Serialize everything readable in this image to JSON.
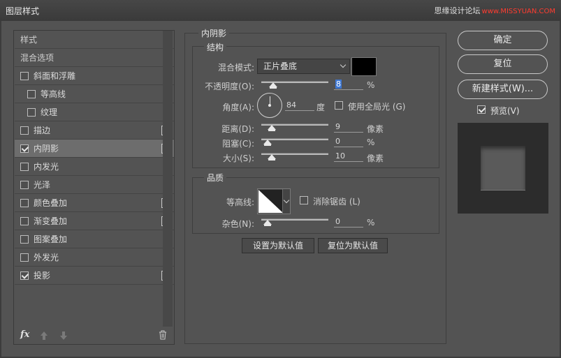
{
  "window": {
    "title": "图层样式",
    "watermark": "思缘设计论坛",
    "watermark_url": "www.MISSYUAN.COM"
  },
  "left_list": {
    "items": [
      {
        "label": "样式",
        "type": "header"
      },
      {
        "label": "混合选项",
        "type": "header"
      },
      {
        "label": "斜面和浮雕",
        "checked": false,
        "plus": false
      },
      {
        "label": "等高线",
        "checked": false,
        "plus": false,
        "sub": true
      },
      {
        "label": "纹理",
        "checked": false,
        "plus": false,
        "sub": true
      },
      {
        "label": "描边",
        "checked": false,
        "plus": true
      },
      {
        "label": "内阴影",
        "checked": true,
        "plus": true,
        "selected": true
      },
      {
        "label": "内发光",
        "checked": false,
        "plus": false
      },
      {
        "label": "光泽",
        "checked": false,
        "plus": false
      },
      {
        "label": "颜色叠加",
        "checked": false,
        "plus": true
      },
      {
        "label": "渐变叠加",
        "checked": false,
        "plus": true
      },
      {
        "label": "图案叠加",
        "checked": false,
        "plus": false
      },
      {
        "label": "外发光",
        "checked": false,
        "plus": false
      },
      {
        "label": "投影",
        "checked": true,
        "plus": true
      }
    ],
    "footer": {
      "fx_label": "fx"
    }
  },
  "inner_shadow": {
    "title": "内阴影",
    "structure": {
      "title": "结构",
      "blend_mode_label": "混合模式:",
      "blend_mode_value": "正片叠底",
      "shadow_color": "#000000",
      "opacity_label": "不透明度(O):",
      "opacity_value": "8",
      "opacity_unit": "%",
      "opacity_level": 0.08,
      "angle_label": "角度(A):",
      "angle_value": "84",
      "angle_unit": "度",
      "global_light_label": "使用全局光 (G)",
      "global_light_checked": false,
      "distance_label": "距离(D):",
      "distance_value": "9",
      "distance_unit": "像素",
      "distance_level": 0.06,
      "choke_label": "阻塞(C):",
      "choke_value": "0",
      "choke_unit": "%",
      "choke_level": 0.0,
      "size_label": "大小(S):",
      "size_value": "10",
      "size_unit": "像素",
      "size_level": 0.06
    },
    "quality": {
      "title": "品质",
      "contour_label": "等高线:",
      "antialias_label": "消除锯齿 (L)",
      "antialias_checked": false,
      "noise_label": "杂色(N):",
      "noise_value": "0",
      "noise_unit": "%",
      "noise_level": 0.0
    },
    "set_default_label": "设置为默认值",
    "reset_default_label": "复位为默认值"
  },
  "right": {
    "ok_label": "确定",
    "reset_label": "复位",
    "new_style_label": "新建样式(W)...",
    "preview_label": "预览(V)",
    "preview_checked": true
  }
}
